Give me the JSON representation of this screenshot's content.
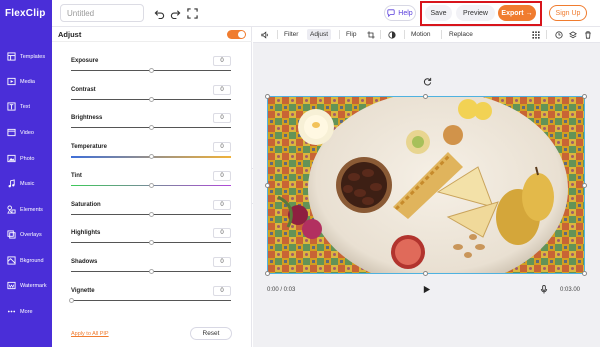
{
  "app": {
    "brand": "FlexClip"
  },
  "header": {
    "title_placeholder": "Untitled",
    "help_label": "Help",
    "save_label": "Save",
    "preview_label": "Preview",
    "export_label": "Export",
    "signup_label": "Sign Up"
  },
  "sidebar": {
    "items": [
      {
        "label": "Templates",
        "icon": "templates-icon"
      },
      {
        "label": "Media",
        "icon": "media-icon"
      },
      {
        "label": "Text",
        "icon": "text-icon"
      },
      {
        "label": "Video",
        "icon": "video-icon"
      },
      {
        "label": "Photo",
        "icon": "photo-icon"
      },
      {
        "label": "Music",
        "icon": "music-icon"
      },
      {
        "label": "Elements",
        "icon": "elements-icon"
      },
      {
        "label": "Overlays",
        "icon": "overlays-icon"
      },
      {
        "label": "Bkground",
        "icon": "background-icon"
      },
      {
        "label": "Watermark",
        "icon": "watermark-icon"
      },
      {
        "label": "More",
        "icon": "more-icon"
      }
    ]
  },
  "panel": {
    "title": "Adjust",
    "toggle_on": true,
    "adjustments": [
      {
        "name": "Exposure",
        "value": "0",
        "level": 0.5
      },
      {
        "name": "Contrast",
        "value": "0",
        "level": 0.5
      },
      {
        "name": "Brightness",
        "value": "0",
        "level": 0.5
      },
      {
        "name": "Temperature",
        "value": "0",
        "level": 0.5
      },
      {
        "name": "Tint",
        "value": "0",
        "level": 0.5
      },
      {
        "name": "Saturation",
        "value": "0",
        "level": 0.5
      },
      {
        "name": "Highlights",
        "value": "0",
        "level": 0.5
      },
      {
        "name": "Shadows",
        "value": "0",
        "level": 0.5
      },
      {
        "name": "Vignette",
        "value": "0",
        "level": 0.0
      }
    ],
    "apply_all_label": "Apply to All PIP",
    "reset_label": "Reset"
  },
  "edit_toolbar": {
    "filter_label": "Filter",
    "adjust_label": "Adjust",
    "flip_label": "Flip",
    "motion_label": "Motion",
    "replace_label": "Replace"
  },
  "player": {
    "current_time": "0:00 / 0:03",
    "duration": "0:03.00"
  },
  "colors": {
    "brand": "#4a2ed8",
    "accent": "#f07c2f",
    "highlight": "#d8141b",
    "selection": "#4fb2e0"
  }
}
